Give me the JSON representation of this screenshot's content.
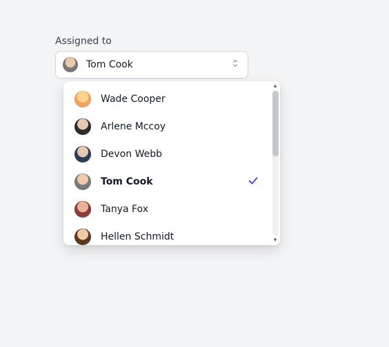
{
  "field": {
    "label": "Assigned to",
    "selected_name": "Tom Cook",
    "selected_avatar_class": "av-d"
  },
  "options": [
    {
      "name": "Wade Cooper",
      "avatar_class": "av-a",
      "selected": false
    },
    {
      "name": "Arlene Mccoy",
      "avatar_class": "av-b",
      "selected": false
    },
    {
      "name": "Devon Webb",
      "avatar_class": "av-c",
      "selected": false
    },
    {
      "name": "Tom Cook",
      "avatar_class": "av-d",
      "selected": true
    },
    {
      "name": "Tanya Fox",
      "avatar_class": "av-e",
      "selected": false
    },
    {
      "name": "Hellen Schmidt",
      "avatar_class": "av-f",
      "selected": false
    }
  ]
}
